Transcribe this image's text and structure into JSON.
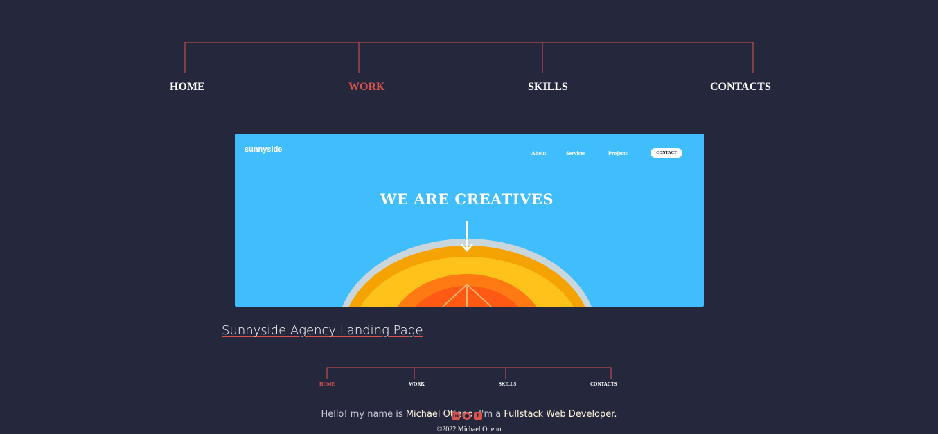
{
  "top_nav": {
    "items": [
      {
        "label": "HOME",
        "active": false
      },
      {
        "label": "WORK",
        "active": true
      },
      {
        "label": "SKILLS",
        "active": false
      },
      {
        "label": "CONTACTS",
        "active": false
      }
    ]
  },
  "project": {
    "title": "Sunnyside Agency Landing Page",
    "preview": {
      "logo": "sunnyside",
      "nav": [
        "About",
        "Services",
        "Projects"
      ],
      "contact": "CONTACT",
      "headline": "WE ARE CREATIVES",
      "arrow_icon": "arrow-down-icon"
    }
  },
  "footer_nav": {
    "items": [
      {
        "label": "HOME",
        "active": true
      },
      {
        "label": "WORK",
        "active": false
      },
      {
        "label": "SKILLS",
        "active": false
      },
      {
        "label": "CONTACTS",
        "active": false
      }
    ]
  },
  "intro": {
    "prefix": "Hello! my name is ",
    "name": "Michael Otieno",
    "middle": ", I'm a ",
    "role": "Fullstack Web Developer."
  },
  "social": [
    "linkedin-icon",
    "github-icon",
    "twitter-icon"
  ],
  "copyright": "©2022 Michael Otieno",
  "colors": {
    "background": "#25273d",
    "accent": "#d9534f",
    "preview_bg": "#3fbdfd"
  }
}
